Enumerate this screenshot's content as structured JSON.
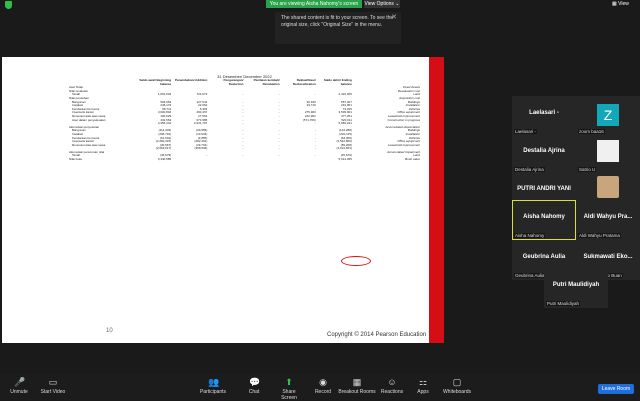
{
  "top": {
    "viewing": "You are viewing Aisha Nahomy's screen",
    "view_options": "View Options ⌄",
    "view": "▦ View",
    "tooltip": "The shared content is fit to your screen. To see the original size, click \"Original Size\" in the menu.",
    "tooltip_close": "✕"
  },
  "slide": {
    "page_number": "10",
    "copyright": "Copyright © 2014 Pearson Education",
    "date_header": "31 Desember/ December 2022",
    "columns": [
      "",
      "Saldo awal/ Beginning balance",
      "Penambahan/ Addition",
      "Pengurangan/ Deduction",
      "Penilaian kembali/ Revaluation",
      "Reklasifikasi/ Reclassification",
      "Saldo akhir/ Ending balance",
      ""
    ],
    "rows": [
      [
        "Aset Tetap",
        "",
        "",
        "",
        "",
        "",
        "",
        "Fixed Assets"
      ],
      [
        "Nilai revaluasi",
        "",
        "",
        "",
        "",
        "",
        "",
        "Revaluation cost"
      ],
      [
        "Tanah",
        "1,691,632",
        "724,673",
        "-",
        "-",
        "-",
        "2,416,305",
        "Land"
      ],
      [
        "Nilai perolehan",
        "",
        "",
        "",
        "",
        "",
        "",
        "Acquisition cost"
      ],
      [
        "Bangunan",
        "503,663",
        "127,544",
        "-",
        "-",
        "26,180",
        "657,407",
        "Buildings"
      ],
      [
        "Instalasi",
        "246,173",
        "22,062",
        "-",
        "-",
        "23,710",
        "291,951",
        "Installation"
      ],
      [
        "Kendaraan bermotor",
        "68,711",
        "5,304",
        "-",
        "-",
        "-",
        "74,015",
        "Vehicles"
      ],
      [
        "Inventaris kantor",
        "3,000,804",
        "260,467",
        "-",
        "-",
        "275,900",
        "3,539,901",
        "Office equipment"
      ],
      [
        "Renovasi atas aset sewa",
        "100,629",
        "27,561",
        "-",
        "-",
        "242,962",
        "377,351",
        "Leasehold improvement"
      ],
      [
        "Aset dalam penyelesaian",
        "432,663",
        "673,985",
        "-",
        "-",
        "(571,706)",
        "520,011",
        "Construction in progress"
      ],
      [
        "",
        "4,355,444",
        "2,041,797",
        "-",
        "-",
        "-",
        "6,983,241",
        ""
      ],
      [
        "Akumulasi penyusutan",
        "",
        "",
        "",
        "",
        "",
        "",
        "Accumulated depreciation"
      ],
      [
        "Bangunan",
        "(114,333)",
        "(29,955)",
        "-",
        "-",
        "-",
        "(144,288)",
        "Buildings"
      ],
      [
        "Instalasi",
        "(206,791)",
        "(13,534)",
        "-",
        "-",
        "-",
        "(220,115)",
        "Installation"
      ],
      [
        "Kendaraan bermotor",
        "(61,601)",
        "(2,855)",
        "-",
        "-",
        "-",
        "(64,456)",
        "Vehicles"
      ],
      [
        "Inventaris kantor",
        "(2,260,315)",
        "(282,491)",
        "-",
        "-",
        "-",
        "(2,542,806)",
        "Office equipment"
      ],
      [
        "Renovasi atas aset sewa",
        "(30,567)",
        "(29,701)",
        "-",
        "-",
        "-",
        "(59,268)",
        "Leasehold improvement"
      ],
      [
        "",
        "(2,663,617)",
        "(368,536)",
        "-",
        "-",
        "-",
        "(3,031,653)",
        ""
      ],
      [
        "Akumulasi penurunan nilai",
        "",
        "",
        "",
        "",
        "",
        "",
        "Accumulated impairment"
      ],
      [
        "Tanah",
        "(45,679)",
        "-",
        "-",
        "-",
        "-",
        "(45,679)",
        "Land"
      ],
      [
        "Nilai buku",
        "3,340,585",
        "",
        "",
        "",
        "",
        "5,614,455",
        "Book value"
      ]
    ]
  },
  "participants": [
    {
      "name": "Laelasari -",
      "label": "Laelasari -"
    },
    {
      "name": "",
      "label": "zoom baa16"
    },
    {
      "name": "Destalia Ajrina",
      "label": "Destalia Ajrina"
    },
    {
      "name": "",
      "label": "Satrio U"
    },
    {
      "name": "PUTRI ANDRI YANI",
      "label": "PUTRI ANDRI YANI"
    },
    {
      "name": "",
      "label": "Yuliana_Yuliana"
    },
    {
      "name": "Aisha Nahomy",
      "label": "Aisha Nahomy"
    },
    {
      "name": "Aldi Wahyu Pra...",
      "label": "Aldi Wahyu Pratama"
    },
    {
      "name": "Geubrina Aulia",
      "label": "Geubrina Aulia"
    },
    {
      "name": "Sukmawati Eko...",
      "label": "Sukmawati Eko Buan"
    },
    {
      "name": "Putri Maulidiyah",
      "label": "Putri Maulidiyah"
    }
  ],
  "toolbar": {
    "unmute": "Unmute",
    "start_video": "Start Video",
    "participants": "Participants",
    "participants_count": "25",
    "chat": "Chat",
    "share_screen": "Share Screen",
    "record": "Record",
    "breakout": "Breakout Rooms",
    "reactions": "Reactions",
    "apps": "Apps",
    "whiteboards": "Whiteboards",
    "leave": "Leave Room"
  },
  "colors": {
    "accent": "#2aa14a",
    "leave": "#1e6fdc",
    "slide_red": "#d40e14",
    "active_border": "#d8e03a"
  }
}
